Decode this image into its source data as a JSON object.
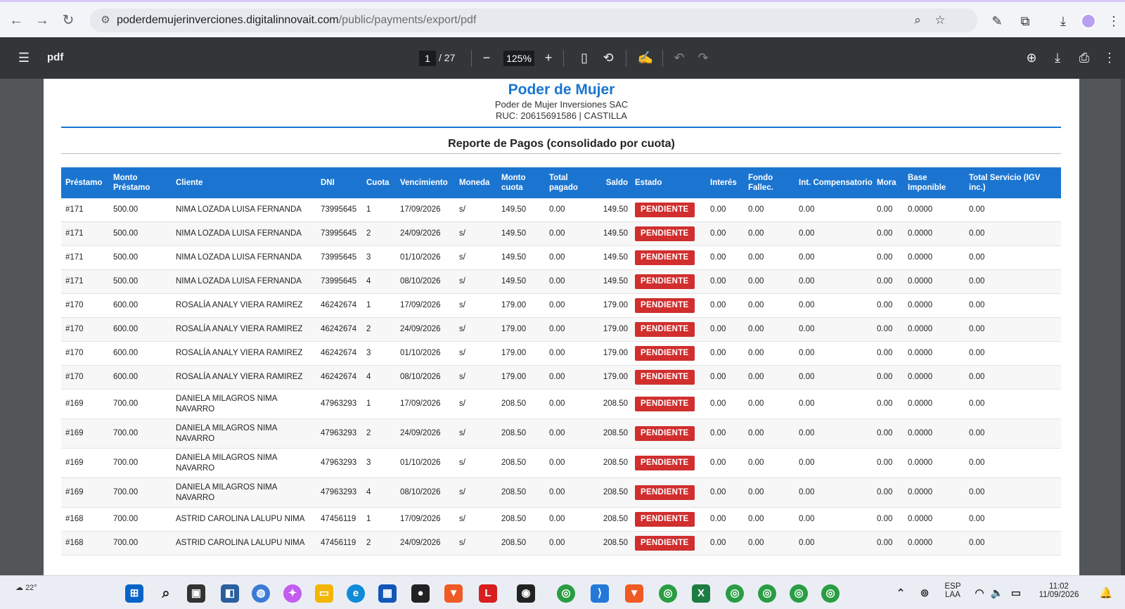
{
  "browser": {
    "url_domain": "poderdemujerinverciones.digitalinnovait.com",
    "url_path": "/public/payments/export/pdf"
  },
  "pdf_toolbar": {
    "title": "pdf",
    "page_current": "1",
    "page_total": "/ 27",
    "zoom": "125%"
  },
  "document": {
    "company": "Poder de Mujer",
    "legal_name": "Poder de Mujer Inversiones SAC",
    "ruc_line": "RUC: 20615691586 | CASTILLA",
    "report_title": "Reporte de Pagos (consolidado por cuota)",
    "columns": [
      "Préstamo",
      "Monto Préstamo",
      "Cliente",
      "DNI",
      "Cuota",
      "Vencimiento",
      "Moneda",
      "Monto cuota",
      "Total pagado",
      "Saldo",
      "Estado",
      "Interés",
      "Fondo Fallec.",
      "Int. Compensatorio",
      "Mora",
      "Base Imponible",
      "Total Servicio (IGV inc.)"
    ],
    "rows": [
      [
        "#171",
        "500.00",
        "NIMA LOZADA LUISA FERNANDA",
        "73995645",
        "1",
        "17/09/2026",
        "s/",
        "149.50",
        "0.00",
        "149.50",
        "PENDIENTE",
        "0.00",
        "0.00",
        "0.00",
        "0.00",
        "0.0000",
        "0.00"
      ],
      [
        "#171",
        "500.00",
        "NIMA LOZADA LUISA FERNANDA",
        "73995645",
        "2",
        "24/09/2026",
        "s/",
        "149.50",
        "0.00",
        "149.50",
        "PENDIENTE",
        "0.00",
        "0.00",
        "0.00",
        "0.00",
        "0.0000",
        "0.00"
      ],
      [
        "#171",
        "500.00",
        "NIMA LOZADA LUISA FERNANDA",
        "73995645",
        "3",
        "01/10/2026",
        "s/",
        "149.50",
        "0.00",
        "149.50",
        "PENDIENTE",
        "0.00",
        "0.00",
        "0.00",
        "0.00",
        "0.0000",
        "0.00"
      ],
      [
        "#171",
        "500.00",
        "NIMA LOZADA LUISA FERNANDA",
        "73995645",
        "4",
        "08/10/2026",
        "s/",
        "149.50",
        "0.00",
        "149.50",
        "PENDIENTE",
        "0.00",
        "0.00",
        "0.00",
        "0.00",
        "0.0000",
        "0.00"
      ],
      [
        "#170",
        "600.00",
        "ROSALÍA ANALY VIERA RAMIREZ",
        "46242674",
        "1",
        "17/09/2026",
        "s/",
        "179.00",
        "0.00",
        "179.00",
        "PENDIENTE",
        "0.00",
        "0.00",
        "0.00",
        "0.00",
        "0.0000",
        "0.00"
      ],
      [
        "#170",
        "600.00",
        "ROSALÍA ANALY VIERA RAMIREZ",
        "46242674",
        "2",
        "24/09/2026",
        "s/",
        "179.00",
        "0.00",
        "179.00",
        "PENDIENTE",
        "0.00",
        "0.00",
        "0.00",
        "0.00",
        "0.0000",
        "0.00"
      ],
      [
        "#170",
        "600.00",
        "ROSALÍA ANALY VIERA RAMIREZ",
        "46242674",
        "3",
        "01/10/2026",
        "s/",
        "179.00",
        "0.00",
        "179.00",
        "PENDIENTE",
        "0.00",
        "0.00",
        "0.00",
        "0.00",
        "0.0000",
        "0.00"
      ],
      [
        "#170",
        "600.00",
        "ROSALÍA ANALY VIERA RAMIREZ",
        "46242674",
        "4",
        "08/10/2026",
        "s/",
        "179.00",
        "0.00",
        "179.00",
        "PENDIENTE",
        "0.00",
        "0.00",
        "0.00",
        "0.00",
        "0.0000",
        "0.00"
      ],
      [
        "#169",
        "700.00",
        "DANIELA MILAGROS NIMA NAVARRO",
        "47963293",
        "1",
        "17/09/2026",
        "s/",
        "208.50",
        "0.00",
        "208.50",
        "PENDIENTE",
        "0.00",
        "0.00",
        "0.00",
        "0.00",
        "0.0000",
        "0.00"
      ],
      [
        "#169",
        "700.00",
        "DANIELA MILAGROS NIMA NAVARRO",
        "47963293",
        "2",
        "24/09/2026",
        "s/",
        "208.50",
        "0.00",
        "208.50",
        "PENDIENTE",
        "0.00",
        "0.00",
        "0.00",
        "0.00",
        "0.0000",
        "0.00"
      ],
      [
        "#169",
        "700.00",
        "DANIELA MILAGROS NIMA NAVARRO",
        "47963293",
        "3",
        "01/10/2026",
        "s/",
        "208.50",
        "0.00",
        "208.50",
        "PENDIENTE",
        "0.00",
        "0.00",
        "0.00",
        "0.00",
        "0.0000",
        "0.00"
      ],
      [
        "#169",
        "700.00",
        "DANIELA MILAGROS NIMA NAVARRO",
        "47963293",
        "4",
        "08/10/2026",
        "s/",
        "208.50",
        "0.00",
        "208.50",
        "PENDIENTE",
        "0.00",
        "0.00",
        "0.00",
        "0.00",
        "0.0000",
        "0.00"
      ],
      [
        "#168",
        "700.00",
        "ASTRID CAROLINA LALUPU NIMA",
        "47456119",
        "1",
        "17/09/2026",
        "s/",
        "208.50",
        "0.00",
        "208.50",
        "PENDIENTE",
        "0.00",
        "0.00",
        "0.00",
        "0.00",
        "0.0000",
        "0.00"
      ],
      [
        "#168",
        "700.00",
        "ASTRID CAROLINA LALUPU NIMA",
        "47456119",
        "2",
        "24/09/2026",
        "s/",
        "208.50",
        "0.00",
        "208.50",
        "PENDIENTE",
        "0.00",
        "0.00",
        "0.00",
        "0.00",
        "0.0000",
        "0.00"
      ]
    ]
  },
  "taskbar": {
    "temperature": "22°",
    "language": "ESP",
    "layout": "LAA",
    "time": "11:02",
    "date": "11/09/2026"
  },
  "colors": {
    "brand_blue": "#1b75d0",
    "status_red": "#d12e2e"
  }
}
